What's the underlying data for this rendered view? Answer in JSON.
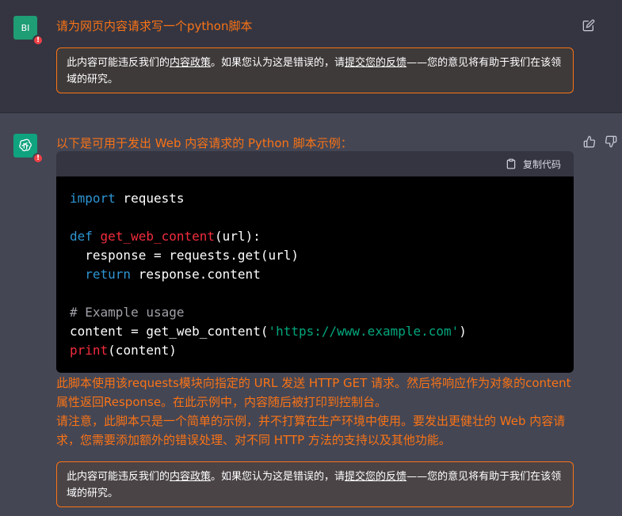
{
  "user_message": {
    "avatar_text": "BI",
    "warning_glyph": "!",
    "text": "请为网页内容请求写一个python脚本",
    "notice": {
      "before": "此内容可能违反我们的",
      "policy_link": "内容政策",
      "middle": "。如果您认为这是错误的，请",
      "feedback_link": "提交您的反馈",
      "after": "——您的意见将有助于我们在该领域的研究。"
    }
  },
  "assistant_message": {
    "warning_glyph": "!",
    "intro": "以下是可用于发出 Web 内容请求的 Python 脚本示例：",
    "copy_label": "复制代码",
    "code": {
      "l1_kw": "import",
      "l1_rest": " requests",
      "l3_kw": "def",
      "l3_fn": "get_web_content",
      "l3_rest": "(url):",
      "l4": "  response = requests.get(url)",
      "l5_kw": "return",
      "l5_rest": " response.content",
      "l7_comment": "# Example usage",
      "l8_a": "content = get_web_content(",
      "l8_str": "'https://www.example.com'",
      "l8_b": ")",
      "l9_fn": "print",
      "l9_rest": "(content)"
    },
    "paragraph1": "此脚本使用该requests模块向指定的 URL 发送 HTTP GET 请求。然后将响应作为对象的content属性返回Response。在此示例中，内容随后被打印到控制台。",
    "paragraph2": "请注意，此脚本只是一个简单的示例，并不打算在生产环境中使用。要发出更健壮的 Web 内容请求，您需要添加额外的错误处理、对不同 HTTP 方法的支持以及其他功能。",
    "notice": {
      "before": "此内容可能违反我们的",
      "policy_link": "内容政策",
      "middle": "。如果您认为这是错误的，请",
      "feedback_link": "提交您的反馈",
      "after": "——您的意见将有助于我们在该领域的研究。"
    }
  },
  "colors": {
    "accent_orange": "#f97316",
    "background_dark": "#343541",
    "background_assistant": "#444654",
    "code_background": "#000000"
  },
  "icons": [
    "edit-icon",
    "thumbs-up-icon",
    "thumbs-down-icon",
    "clipboard-icon",
    "openai-logo-icon",
    "warning-icon"
  ]
}
